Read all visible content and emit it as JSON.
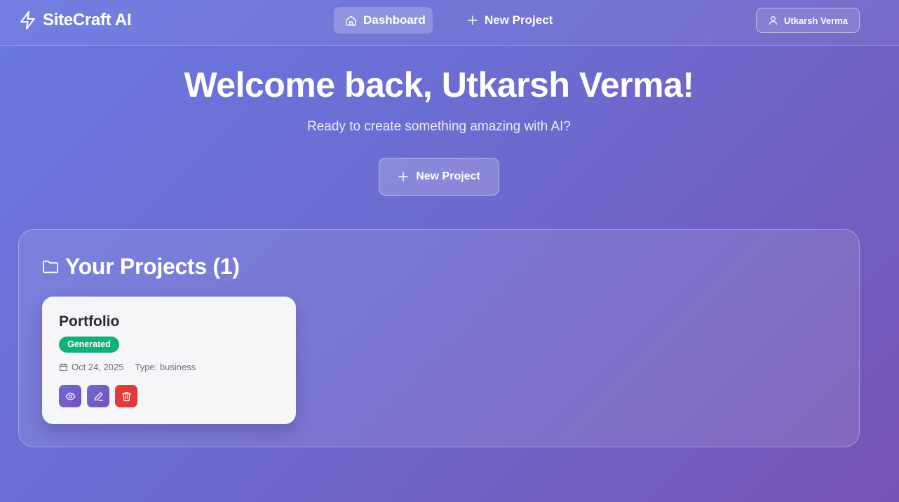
{
  "navbar": {
    "brand": "SiteCraft AI",
    "brand_icon": "lightning-bolt-icon",
    "links": [
      {
        "label": "Dashboard",
        "icon": "home-icon",
        "active": true
      },
      {
        "label": "New Project",
        "icon": "plus-icon",
        "active": false
      }
    ],
    "user": {
      "name": "Utkarsh Verma",
      "icon": "user-icon"
    }
  },
  "hero": {
    "title": "Welcome back, Utkarsh Verma!",
    "subtitle": "Ready to create something amazing with AI?",
    "button_label": "New Project"
  },
  "projects": {
    "title": "Your Projects (1)",
    "icon": "folder-icon",
    "items": [
      {
        "name": "Portfolio",
        "status": "Generated",
        "date": "Oct 24, 2025",
        "type": "Type: business",
        "actions": [
          "eye-icon",
          "edit-icon",
          "trash-icon"
        ]
      }
    ]
  },
  "colors": {
    "background_start": "#6a78e0",
    "background_end": "#7654b3",
    "status_generated": "#10b07a",
    "delete": "#e23a3a",
    "card_bg": "#f6f6f9"
  }
}
